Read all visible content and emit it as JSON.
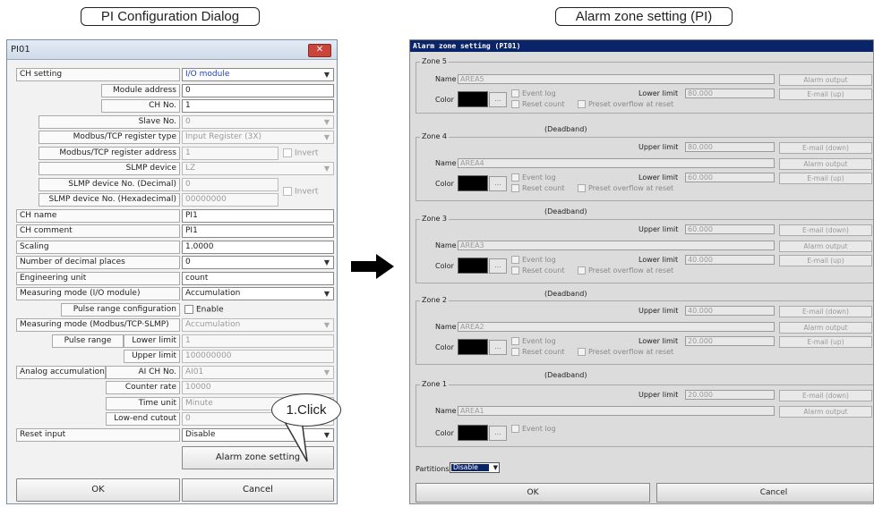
{
  "captions": {
    "left": "PI Configuration Dialog",
    "right": "Alarm zone setting (PI)"
  },
  "left_dialog": {
    "title": "PI01",
    "close": "✕",
    "rows": {
      "ch_setting": {
        "label": "CH setting",
        "value": "I/O module"
      },
      "module_address": {
        "label": "Module address",
        "value": "0"
      },
      "ch_no": {
        "label": "CH No.",
        "value": "1"
      },
      "slave_no": {
        "label": "Slave No.",
        "value": "0"
      },
      "modbus_reg_type": {
        "label": "Modbus/TCP register type",
        "value": "Input Register (3X)"
      },
      "modbus_reg_addr": {
        "label": "Modbus/TCP register address",
        "value": "1",
        "check": "Invert"
      },
      "slmp_device": {
        "label": "SLMP device",
        "value": "LZ"
      },
      "slmp_dec": {
        "label": "SLMP device No. (Decimal)",
        "value": "0",
        "check": "Invert"
      },
      "slmp_hex": {
        "label": "SLMP device No. (Hexadecimal)",
        "value": "00000000"
      },
      "ch_name": {
        "label": "CH name",
        "value": "PI1"
      },
      "ch_comment": {
        "label": "CH comment",
        "value": "PI1"
      },
      "scaling": {
        "label": "Scaling",
        "value": "1.0000"
      },
      "decimal_places": {
        "label": "Number of decimal places",
        "value": "0"
      },
      "eng_unit": {
        "label": "Engineering unit",
        "value": "count"
      },
      "meas_mode_io": {
        "label": "Measuring mode (I/O module)",
        "value": "Accumulation"
      },
      "pulse_range_cfg": {
        "label": "Pulse range configuration",
        "check": "Enable"
      },
      "meas_mode_modbus": {
        "label": "Measuring mode (Modbus/TCP·SLMP)",
        "value": "Accumulation"
      },
      "pulse_lower": {
        "group": "Pulse range",
        "label": "Lower limit",
        "value": "1"
      },
      "pulse_upper": {
        "label": "Upper limit",
        "value": "100000000"
      },
      "ai_ch_no": {
        "group": "Analog accumulation",
        "label": "AI CH No.",
        "value": "AI01"
      },
      "counter_rate": {
        "label": "Counter rate",
        "value": "10000"
      },
      "time_unit": {
        "label": "Time unit",
        "value": "Minute"
      },
      "low_cutout": {
        "label": "Low-end cutout",
        "value": "0"
      },
      "reset_input": {
        "label": "Reset input",
        "value": "Disable"
      }
    },
    "alarm_zone_button": "Alarm zone setting",
    "ok": "OK",
    "cancel": "Cancel",
    "callout": "1.Click"
  },
  "right_dialog": {
    "title": "Alarm zone setting (PI01)",
    "labels": {
      "name": "Name",
      "color": "Color",
      "upper_limit": "Upper limit",
      "lower_limit": "Lower limit",
      "event_log": "Event log",
      "reset_count": "Reset count",
      "preset_overflow": "Preset overflow at reset",
      "deadband": "(Deadband)",
      "alarm_output": "Alarm output",
      "email_up": "E-mail (up)",
      "email_down": "E-mail (down)",
      "dots": "..."
    },
    "zones": [
      {
        "title": "Zone 5",
        "name": "AREA5",
        "lower": "80.000"
      },
      {
        "title": "Zone 4",
        "name": "AREA4",
        "upper": "80.000",
        "lower": "60.000"
      },
      {
        "title": "Zone 3",
        "name": "AREA3",
        "upper": "60.000",
        "lower": "40.000"
      },
      {
        "title": "Zone 2",
        "name": "AREA2",
        "upper": "40.000",
        "lower": "20.000"
      },
      {
        "title": "Zone 1",
        "name": "AREA1",
        "upper": "20.000"
      }
    ],
    "partitions_label": "Partitions",
    "partitions_value": "Disable",
    "ok": "OK",
    "cancel": "Cancel"
  }
}
